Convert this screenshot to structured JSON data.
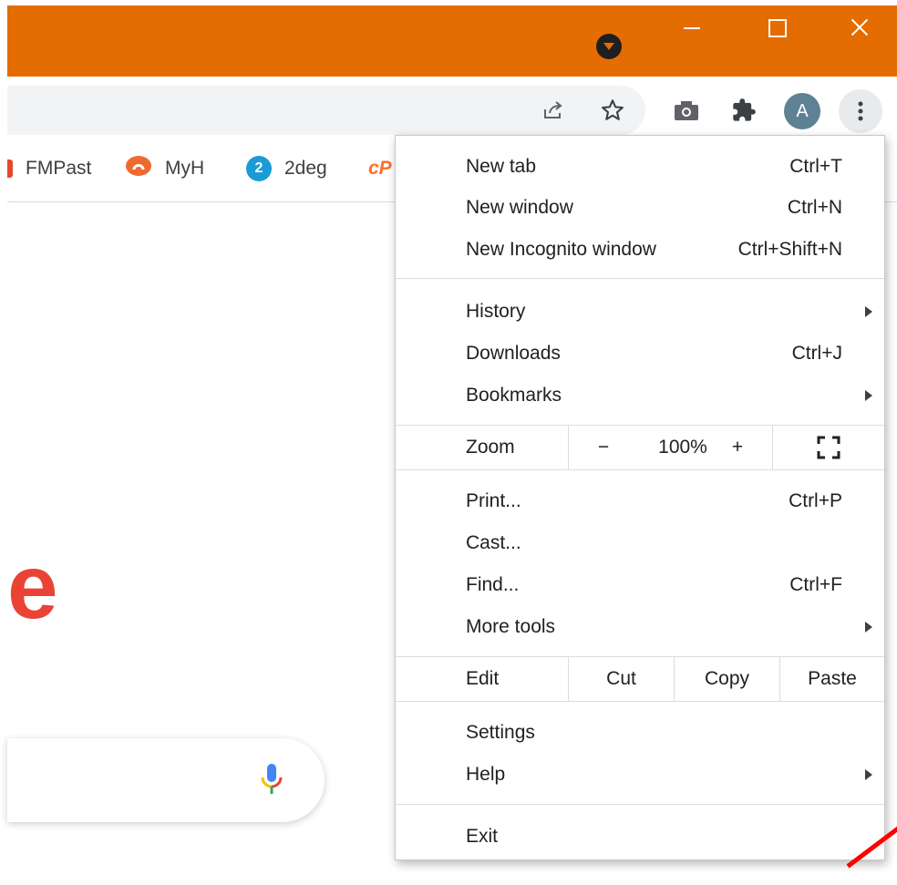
{
  "window": {
    "title_bar_color": "#e46c00"
  },
  "toolbar": {
    "profile_initial": "A"
  },
  "bookmarks": [
    {
      "label": "FMPast",
      "icon": "fmpast-favicon"
    },
    {
      "label": "MyH",
      "icon": "myh-favicon"
    },
    {
      "label": "2deg",
      "icon": "2deg-favicon"
    },
    {
      "label": "",
      "icon": "cpanel-favicon"
    }
  ],
  "page": {
    "logo_partial": "e"
  },
  "menu": {
    "new_tab": {
      "label": "New tab",
      "shortcut": "Ctrl+T"
    },
    "new_window": {
      "label": "New window",
      "shortcut": "Ctrl+N"
    },
    "new_incognito": {
      "label": "New Incognito window",
      "shortcut": "Ctrl+Shift+N"
    },
    "history": {
      "label": "History"
    },
    "downloads": {
      "label": "Downloads",
      "shortcut": "Ctrl+J"
    },
    "bookmarks": {
      "label": "Bookmarks"
    },
    "zoom": {
      "label": "Zoom",
      "minus": "−",
      "value": "100%",
      "plus": "+"
    },
    "print": {
      "label": "Print...",
      "shortcut": "Ctrl+P"
    },
    "cast": {
      "label": "Cast..."
    },
    "find": {
      "label": "Find...",
      "shortcut": "Ctrl+F"
    },
    "more_tools": {
      "label": "More tools"
    },
    "edit": {
      "label": "Edit",
      "cut": "Cut",
      "copy": "Copy",
      "paste": "Paste"
    },
    "settings": {
      "label": "Settings"
    },
    "help": {
      "label": "Help"
    },
    "exit": {
      "label": "Exit"
    }
  },
  "colors": {
    "accent_orange": "#e46c00",
    "google_red": "#ea4335",
    "annotation_red": "#ff0000"
  }
}
